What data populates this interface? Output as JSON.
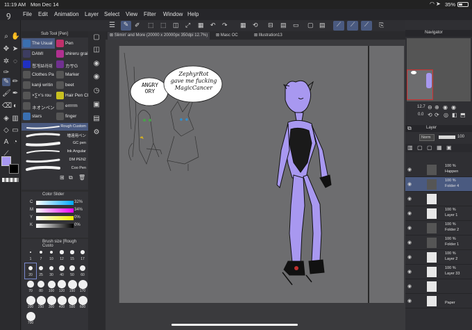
{
  "status": {
    "time": "11:19 AM",
    "date": "Mon Dec 14",
    "battery": "35%"
  },
  "menu": [
    "File",
    "Edit",
    "Animation",
    "Layer",
    "Select",
    "View",
    "Filter",
    "Window",
    "Help"
  ],
  "subtool": {
    "header": "Sub Tool [Pen]",
    "items": [
      {
        "label": "The Usual",
        "color": "#3a6fb0",
        "selected": true
      },
      {
        "label": "Pen",
        "color": "#c0306a"
      },
      {
        "label": "DAMI",
        "color": "#3d3d60"
      },
      {
        "label": "shireru grai",
        "color": "#b03090"
      },
      {
        "label": "청개브러쉬",
        "color": "#2030c0"
      },
      {
        "label": "カサG",
        "color": "#703090"
      },
      {
        "label": "Clothes Pa",
        "color": "#555"
      },
      {
        "label": "Marker",
        "color": "#555"
      },
      {
        "label": "kanji writin",
        "color": "#555"
      },
      {
        "label": "beet",
        "color": "#555"
      },
      {
        "label": "×∑×'s rou",
        "color": "#555"
      },
      {
        "label": "Hair Pen Cl",
        "color": "#c8c020"
      },
      {
        "label": "ネオンペン",
        "color": "#555"
      },
      {
        "label": "errrrm",
        "color": "#555"
      },
      {
        "label": "stars",
        "color": "#3a6fb0"
      },
      {
        "label": "finger",
        "color": "#555"
      }
    ],
    "brushes": [
      "Rough Custom",
      "増遠用ペン",
      "GC pen",
      "Ink Angular",
      "DM PEN2",
      "Coo Pen"
    ]
  },
  "color_slider": {
    "header": "Color Slider",
    "rows": [
      {
        "label": "C",
        "value": "32%"
      },
      {
        "label": "M",
        "value": "34%"
      },
      {
        "label": "Y",
        "value": "0%"
      },
      {
        "label": "K",
        "value": "0%"
      }
    ]
  },
  "brush_size": {
    "header": "Brush size [Rough Custo",
    "sizes": [
      "1",
      "7",
      "10",
      "12",
      "15",
      "17",
      "20",
      "25",
      "30",
      "40",
      "50",
      "60",
      "70",
      "80",
      "100",
      "120",
      "150",
      "170",
      "200",
      "250",
      "300",
      "400",
      "500",
      "600",
      "700"
    ]
  },
  "tabs": [
    {
      "label": "Slimin' and More (20000 x 20000px 350dpi 12.7%)",
      "active": true
    },
    {
      "label": "Masc OC"
    },
    {
      "label": "Illustration13"
    }
  ],
  "canvas_text": {
    "bubble1": [
      "ANGRY",
      "ORY"
    ],
    "bubble2": [
      "ZephyrRot",
      "gave me fucking",
      "MagicCancer"
    ]
  },
  "navigator": {
    "header": "Navigator",
    "zoom": "12.7",
    "angle": "0.0"
  },
  "layer_panel": {
    "header": "Layer",
    "blend": "Norm",
    "opacity": "100",
    "layers": [
      {
        "pct": "100 %",
        "name": "Happen"
      },
      {
        "pct": "100 %",
        "name": "Folder 4",
        "selected": true
      },
      {
        "pct": "",
        "name": ""
      },
      {
        "pct": "100 %",
        "name": "Layer 1"
      },
      {
        "pct": "100 %",
        "name": "Folder 2"
      },
      {
        "pct": "100 %",
        "name": "Folder 1"
      },
      {
        "pct": "100 %",
        "name": "Layer 2"
      },
      {
        "pct": "100 %",
        "name": "Layer 33"
      },
      {
        "pct": "",
        "name": ""
      },
      {
        "pct": "",
        "name": "Paper"
      }
    ]
  },
  "colors": {
    "accent": "#9a8ff0",
    "main_color": "#a898f0",
    "sub_color": "#000000"
  }
}
